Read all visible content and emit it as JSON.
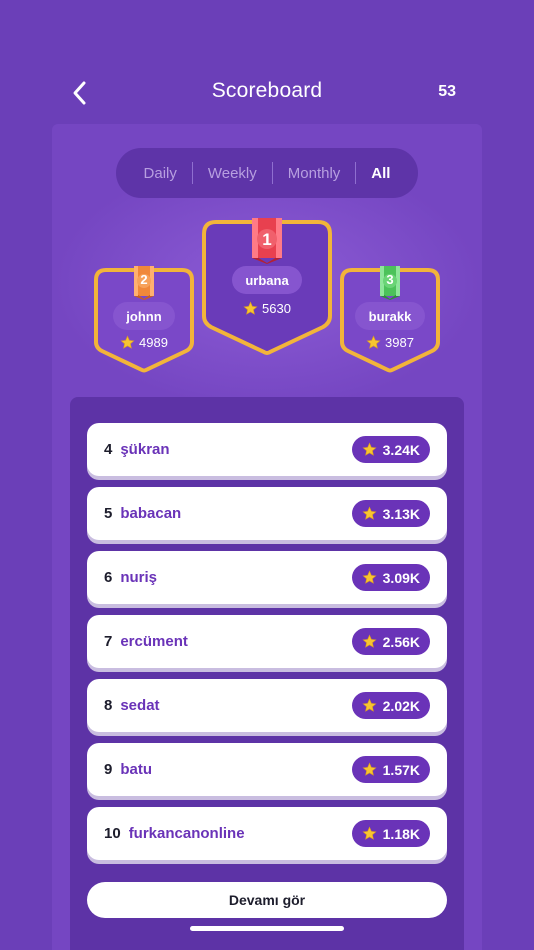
{
  "header": {
    "title": "Scoreboard",
    "coins": "53"
  },
  "tabs": [
    {
      "label": "Daily",
      "active": false
    },
    {
      "label": "Weekly",
      "active": false
    },
    {
      "label": "Monthly",
      "active": false
    },
    {
      "label": "All",
      "active": true
    }
  ],
  "podium": {
    "first": {
      "rank": "1",
      "name": "urbana",
      "score": "5630",
      "medal_color": "#e8404f"
    },
    "second": {
      "rank": "2",
      "name": "johnn",
      "score": "4989",
      "medal_color": "#f0883a"
    },
    "third": {
      "rank": "3",
      "name": "burakk",
      "score": "3987",
      "medal_color": "#4cc25a"
    }
  },
  "leaderboard": [
    {
      "rank": "4",
      "name": "şükran",
      "score": "3.24K"
    },
    {
      "rank": "5",
      "name": "babacan",
      "score": "3.13K"
    },
    {
      "rank": "6",
      "name": "nuriş",
      "score": "3.09K"
    },
    {
      "rank": "7",
      "name": "ercüment",
      "score": "2.56K"
    },
    {
      "rank": "8",
      "name": "sedat",
      "score": "2.02K"
    },
    {
      "rank": "9",
      "name": "batu",
      "score": "1.57K"
    },
    {
      "rank": "10",
      "name": "furkancanonline",
      "score": "1.18K"
    }
  ],
  "more_button": {
    "label": "Devamı gör"
  },
  "colors": {
    "background": "#6b3fb8",
    "accent": "#6a33b8",
    "gold_border": "#f2b43a",
    "star": "#f7c531"
  },
  "icons": {
    "back": "chevron-left-icon",
    "star": "star-icon",
    "medal": "ribbon-medal-icon"
  }
}
